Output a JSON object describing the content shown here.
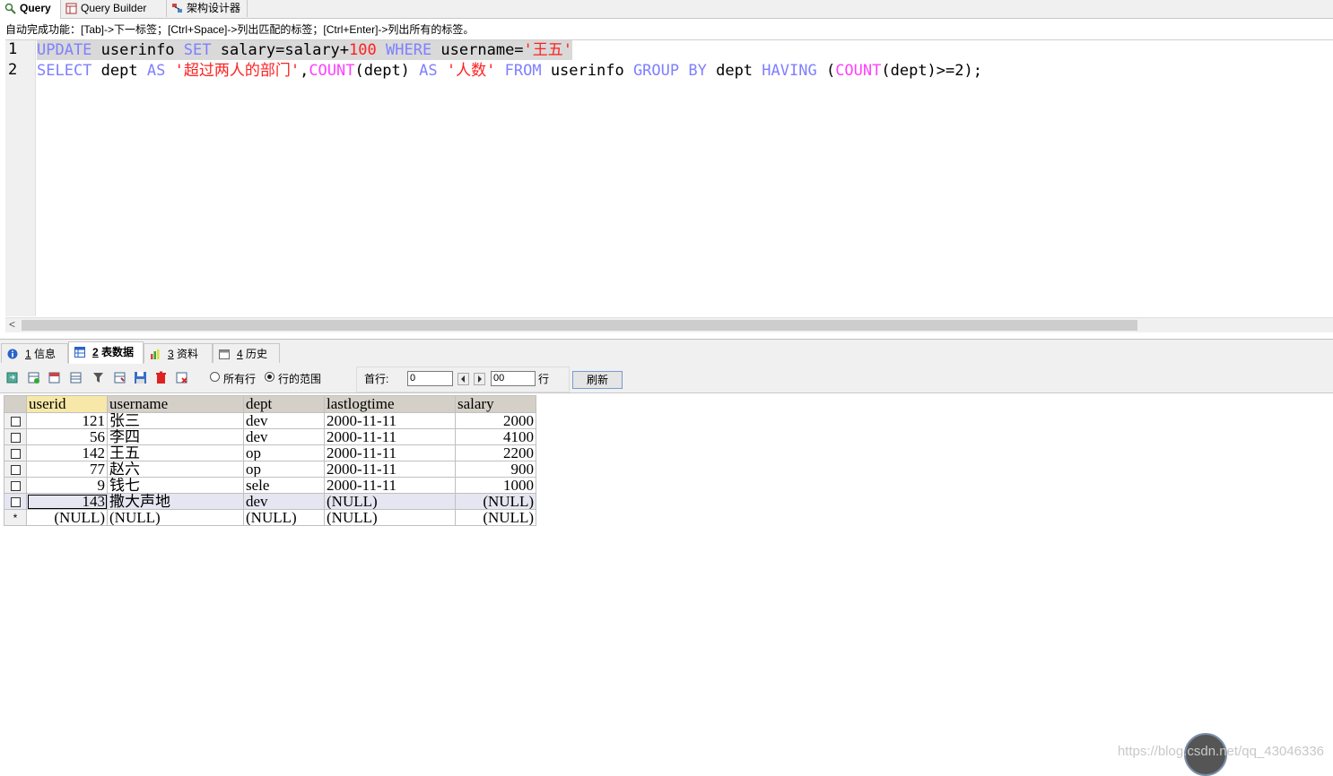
{
  "top_tabs": [
    {
      "label": "Query",
      "icon": "query-icon",
      "active": true
    },
    {
      "label": "Query Builder",
      "icon": "query-builder-icon",
      "active": false
    },
    {
      "label": "架构设计器",
      "icon": "schema-designer-icon",
      "active": false
    }
  ],
  "hint": "自动完成功能：[Tab]->下一标签；[Ctrl+Space]->列出匹配的标签；[Ctrl+Enter]->列出所有的标签。",
  "editor": {
    "line_numbers": [
      "1",
      "2"
    ],
    "line1": {
      "kw_update": "UPDATE",
      "t1": " userinfo ",
      "kw_set": "SET",
      "t2": " salary=salary+",
      "n100": "100",
      "t3": " ",
      "kw_where": "WHERE",
      "t4": " username=",
      "s1": "'王五'"
    },
    "line2": {
      "kw_select": "SELECT",
      "t1": " dept ",
      "kw_as1": "AS",
      "t2": " ",
      "s1": "'超过两人的部门'",
      "t3": ",",
      "fn_count1": "COUNT",
      "t4": "(dept) ",
      "kw_as2": "AS",
      "t5": " ",
      "s2": "'人数'",
      "t6": " ",
      "kw_from": "FROM",
      "t7": " userinfo ",
      "kw_group": "GROUP",
      "t8": " ",
      "kw_by": "BY",
      "t9": " dept ",
      "kw_having": "HAVING",
      "t10": " (",
      "fn_count2": "COUNT",
      "t11": "(dept)>=2);"
    },
    "scroll_left": "<"
  },
  "bottom_tabs": [
    {
      "num": "1",
      "label": " 信息",
      "icon": "info-icon"
    },
    {
      "num": "2",
      "label": " 表数据",
      "icon": "table-data-icon",
      "active": true
    },
    {
      "num": "3",
      "label": " 资料",
      "icon": "info-chart-icon"
    },
    {
      "num": "4",
      "label": " 历史",
      "icon": "history-icon"
    }
  ],
  "toolbar": {
    "all_rows": "所有行",
    "row_range": "行的范围",
    "first_row_label": "首行:",
    "first_row_value": "0",
    "row_count_value": "00",
    "rows_label": "行",
    "refresh": "刷新"
  },
  "grid": {
    "columns": [
      "userid",
      "username",
      "dept",
      "lastlogtime",
      "salary"
    ],
    "rows": [
      {
        "userid": "121",
        "username": "张三",
        "dept": "dev",
        "lastlogtime": "2000-11-11",
        "salary": "2000"
      },
      {
        "userid": "56",
        "username": "李四",
        "dept": "dev",
        "lastlogtime": "2000-11-11",
        "salary": "4100"
      },
      {
        "userid": "142",
        "username": "王五",
        "dept": "op",
        "lastlogtime": "2000-11-11",
        "salary": "2200"
      },
      {
        "userid": "77",
        "username": "赵六",
        "dept": "op",
        "lastlogtime": "2000-11-11",
        "salary": "900"
      },
      {
        "userid": "9",
        "username": "钱七",
        "dept": "sele",
        "lastlogtime": "2000-11-11",
        "salary": "1000"
      },
      {
        "userid": "143",
        "username": "撒大声地",
        "dept": "dev",
        "lastlogtime": "(NULL)",
        "salary": "(NULL)"
      }
    ],
    "new_row": {
      "marker": "*",
      "userid": "(NULL)",
      "username": "(NULL)",
      "dept": "(NULL)",
      "lastlogtime": "(NULL)",
      "salary": "(NULL)"
    }
  },
  "watermark": "https://blog.csdn.net/qq_43046336",
  "colors": {
    "keyword": "#7f7fff",
    "function": "#ff40ff",
    "string": "#ff2020"
  }
}
